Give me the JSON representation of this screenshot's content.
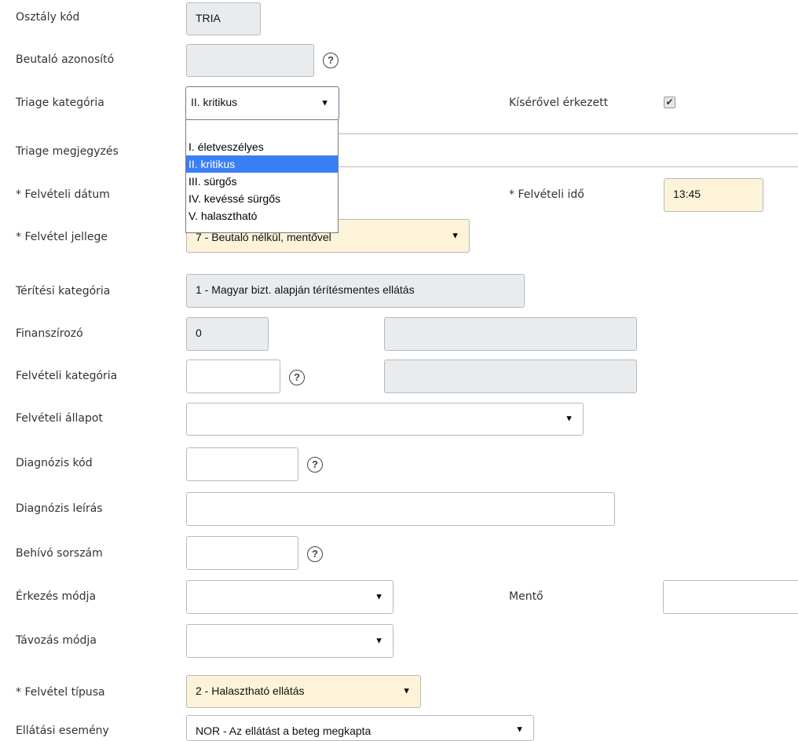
{
  "fields": {
    "osztaly_kod": {
      "label": "Osztály kód",
      "value": "TRIA"
    },
    "beutalo_azonosito": {
      "label": "Beutaló azonosító",
      "value": ""
    },
    "triage_kategoria": {
      "label": "Triage kategória",
      "value": "II. kritikus",
      "options": [
        "I. életveszélyes",
        "II. kritikus",
        "III. sürgős",
        "IV. kevéssé sürgős",
        "V. halasztható"
      ],
      "selected_index": 1
    },
    "kiserovel_erkezett": {
      "label": "Kísérővel érkezett",
      "checked": true
    },
    "triage_megjegyzes": {
      "label": "Triage megjegyzés",
      "value": ""
    },
    "felveteli_datum": {
      "label": "* Felvételi dátum",
      "value": ""
    },
    "felveteli_ido": {
      "label": "* Felvételi idő",
      "value": "13:45"
    },
    "felvetel_jellege": {
      "label": "* Felvétel jellege",
      "value": "7 - Beutaló nélkül, mentővel"
    },
    "teritesi_kategoria": {
      "label": "Térítési kategória",
      "value": "1 - Magyar bizt. alapján térítésmentes ellátás"
    },
    "finanszirozo": {
      "label": "Finanszírozó",
      "value": "0",
      "desc": ""
    },
    "felveteli_kategoria": {
      "label": "Felvételi kategória",
      "value": "",
      "desc": ""
    },
    "felveteli_allapot": {
      "label": "Felvételi állapot",
      "value": ""
    },
    "diagnozis_kod": {
      "label": "Diagnózis kód",
      "value": ""
    },
    "diagnozis_leiras": {
      "label": "Diagnózis leírás",
      "value": ""
    },
    "behivo_sorszam": {
      "label": "Behívó sorszám",
      "value": ""
    },
    "erkezes_modja": {
      "label": "Érkezés módja",
      "value": ""
    },
    "mento": {
      "label": "Mentő",
      "value": ""
    },
    "tavozas_modja": {
      "label": "Távozás módja",
      "value": ""
    },
    "felvetel_tipusa": {
      "label": "* Felvétel típusa",
      "value": "2 - Halasztható ellátás"
    },
    "ellatasi_esemeny": {
      "label": "Ellátási esemény",
      "value": "NOR - Az ellátást a beteg megkapta"
    }
  },
  "icons": {
    "help": "?",
    "check": "✔",
    "dropdown_arrow": "▼"
  },
  "colors": {
    "readonly_bg": "#e9ecef",
    "required_bg": "#fcf3d9",
    "option_highlight": "#3a7ff5"
  }
}
